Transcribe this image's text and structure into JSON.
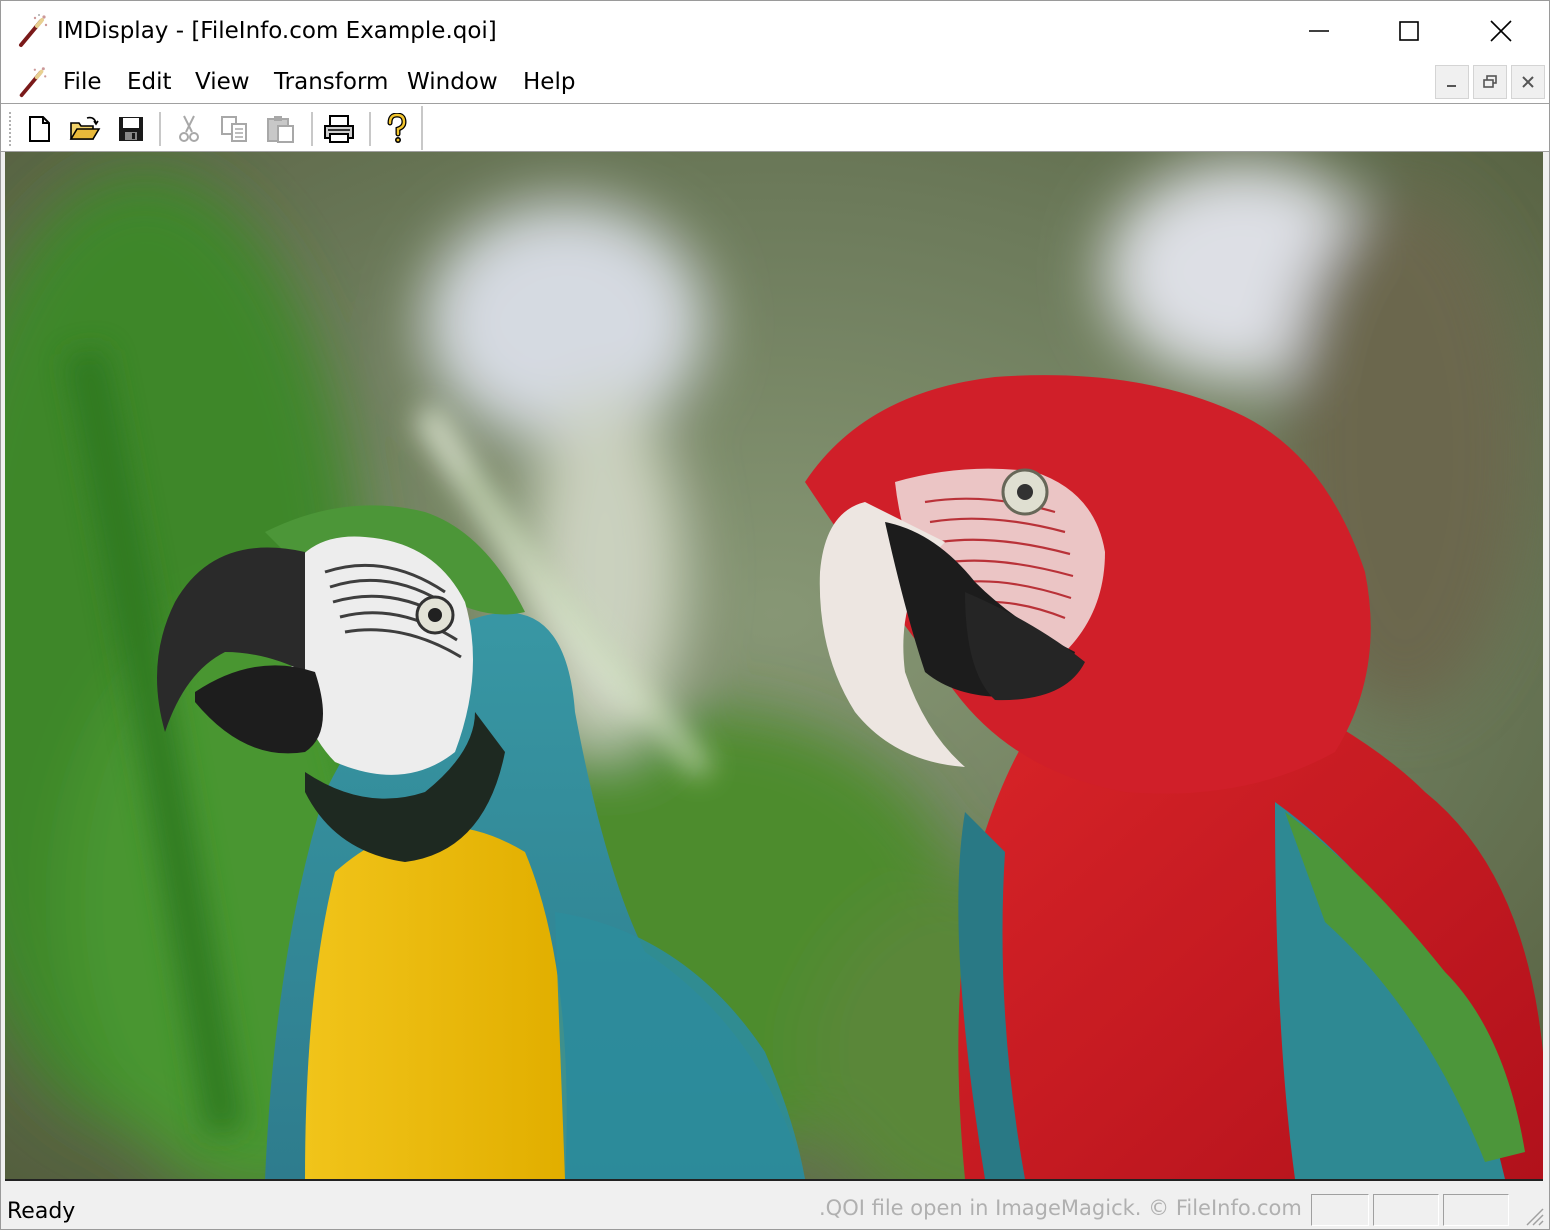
{
  "window": {
    "title": "IMDisplay - [FileInfo.com Example.qoi]",
    "app_icon": "magic-wand-icon"
  },
  "caption_buttons": {
    "minimize": "minimize-icon",
    "maximize": "maximize-icon",
    "close": "close-icon"
  },
  "menu": {
    "items": [
      {
        "label": "File"
      },
      {
        "label": "Edit"
      },
      {
        "label": "View"
      },
      {
        "label": "Transform"
      },
      {
        "label": "Window"
      },
      {
        "label": "Help"
      }
    ],
    "child_icon": "magic-wand-icon",
    "child_buttons": [
      "minimize-icon",
      "restore-icon",
      "close-icon"
    ]
  },
  "toolbar": {
    "buttons": [
      {
        "icon": "new-document-icon",
        "enabled": true
      },
      {
        "icon": "open-folder-icon",
        "enabled": true
      },
      {
        "icon": "save-icon",
        "enabled": true
      },
      {
        "icon": "cut-icon",
        "enabled": false
      },
      {
        "icon": "copy-icon",
        "enabled": false
      },
      {
        "icon": "paste-icon",
        "enabled": false
      },
      {
        "icon": "print-icon",
        "enabled": true
      },
      {
        "icon": "help-icon",
        "enabled": true
      }
    ]
  },
  "document": {
    "image_subject": "two macaws (blue-and-yellow and red-and-green)"
  },
  "status": {
    "ready_text": "Ready",
    "watermark_text": ".QOI file open in ImageMagick. © FileInfo.com"
  },
  "colors": {
    "titlebar_bg": "#ffffff",
    "chrome_bg": "#f0f0f0",
    "watermark": "#b0b0b0"
  }
}
